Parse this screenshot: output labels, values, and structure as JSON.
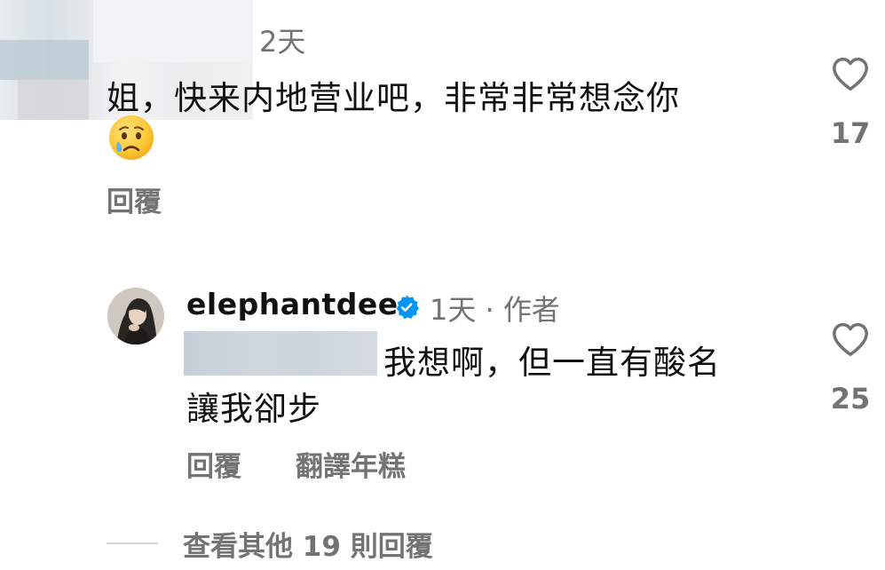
{
  "top_comment": {
    "time": "2天",
    "text": "姐，快来内地营业吧，非常非常想念你",
    "emoji": "crying-face",
    "reply_label": "回覆",
    "like_count": "17"
  },
  "reply_comment": {
    "username": "elephantdee",
    "meta": "1天 · 作者",
    "text_line1": "我想啊，但一直有酸名",
    "text_line2": "讓我卻步",
    "reply_label": "回覆",
    "translate_label": "翻譯年糕",
    "like_count": "25"
  },
  "view_more": {
    "label": "查看其他 19 則回覆"
  },
  "colors": {
    "secondary_text": "#737373",
    "primary_text": "#111111",
    "verified_blue": "#0095f6"
  }
}
